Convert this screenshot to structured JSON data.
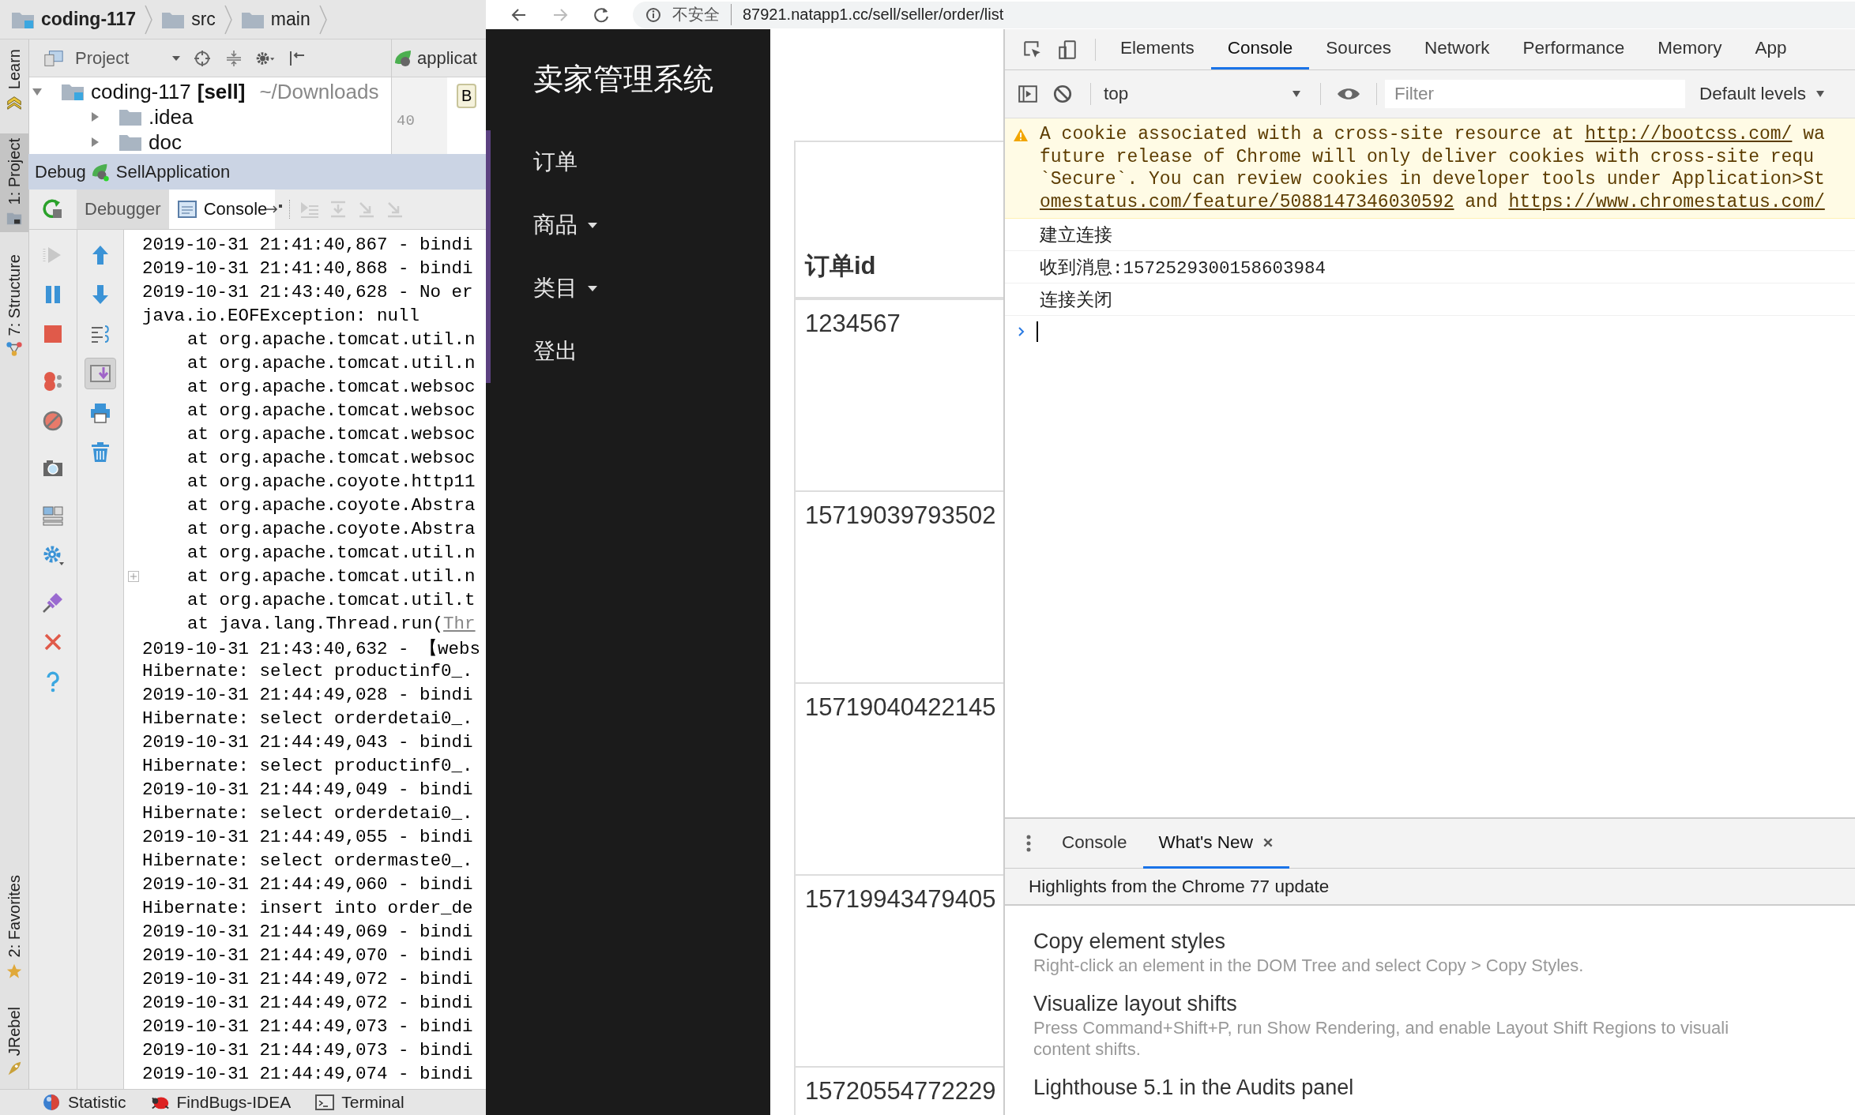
{
  "ide": {
    "breadcrumbs": [
      "coding-117",
      "src",
      "main"
    ],
    "tool_strip_top": [
      {
        "label": "Learn",
        "selected": false
      },
      {
        "label": "1: Project",
        "selected": true
      },
      {
        "label": "7: Structure",
        "selected": false
      }
    ],
    "tool_strip_bottom": [
      {
        "label": "2: Favorites",
        "selected": false
      },
      {
        "label": "JRebel",
        "selected": false
      }
    ],
    "project_panel": {
      "title": "Project",
      "tree": [
        {
          "name": "coding-117",
          "module": "[sell]",
          "path": "~/Downloads",
          "expanded": true,
          "children": [
            {
              "name": ".idea",
              "expanded": false
            },
            {
              "name": "doc",
              "expanded": false
            }
          ]
        }
      ]
    },
    "editor": {
      "tab": "applicat",
      "button": "B",
      "line_number": "40"
    },
    "debug": {
      "title": "Debug",
      "config": "SellApplication",
      "tabs": [
        {
          "label": "Debugger",
          "selected": false
        },
        {
          "label": "Console",
          "selected": true
        }
      ],
      "log": [
        {
          "kind": "text",
          "text": "2019-10-31 21:41:40,867 - bindi"
        },
        {
          "kind": "text",
          "text": "2019-10-31 21:41:40,868 - bindi"
        },
        {
          "kind": "text",
          "text": "2019-10-31 21:43:40,628 - No er"
        },
        {
          "kind": "text",
          "text": "java.io.EOFException: null"
        },
        {
          "kind": "stack",
          "text": "at org.apache.tomcat.util.n"
        },
        {
          "kind": "stack",
          "text": "at org.apache.tomcat.util.n"
        },
        {
          "kind": "stack",
          "text": "at org.apache.tomcat.websoc"
        },
        {
          "kind": "stack",
          "text": "at org.apache.tomcat.websoc"
        },
        {
          "kind": "stack",
          "text": "at org.apache.tomcat.websoc"
        },
        {
          "kind": "stack",
          "text": "at org.apache.tomcat.websoc"
        },
        {
          "kind": "stack",
          "text": "at org.apache.coyote.http11"
        },
        {
          "kind": "stack",
          "text": "at org.apache.coyote.Abstra"
        },
        {
          "kind": "stack",
          "text": "at org.apache.coyote.Abstra"
        },
        {
          "kind": "stack",
          "text": "at org.apache.tomcat.util.n"
        },
        {
          "kind": "stack_fold",
          "text": "at org.apache.tomcat.util.n"
        },
        {
          "kind": "stack",
          "text": "at org.apache.tomcat.util.t"
        },
        {
          "kind": "stack",
          "text": "at java.lang.Thread.run(",
          "link": "Thr"
        },
        {
          "kind": "text",
          "text": "2019-10-31 21:43:40,632 - 【webs"
        },
        {
          "kind": "text",
          "text": "Hibernate: select productinf0_."
        },
        {
          "kind": "text",
          "text": "2019-10-31 21:44:49,028 - bindi"
        },
        {
          "kind": "text",
          "text": "Hibernate: select orderdetai0_."
        },
        {
          "kind": "text",
          "text": "2019-10-31 21:44:49,043 - bindi"
        },
        {
          "kind": "text",
          "text": "Hibernate: select productinf0_."
        },
        {
          "kind": "text",
          "text": "2019-10-31 21:44:49,049 - bindi"
        },
        {
          "kind": "text",
          "text": "Hibernate: select orderdetai0_."
        },
        {
          "kind": "text",
          "text": "2019-10-31 21:44:49,055 - bindi"
        },
        {
          "kind": "text",
          "text": "Hibernate: select ordermaste0_."
        },
        {
          "kind": "text",
          "text": "2019-10-31 21:44:49,060 - bindi"
        },
        {
          "kind": "text",
          "text": "Hibernate: insert into order_de"
        },
        {
          "kind": "text",
          "text": "2019-10-31 21:44:49,069 - bindi"
        },
        {
          "kind": "text",
          "text": "2019-10-31 21:44:49,070 - bindi"
        },
        {
          "kind": "text",
          "text": "2019-10-31 21:44:49,072 - bindi"
        },
        {
          "kind": "text",
          "text": "2019-10-31 21:44:49,072 - bindi"
        },
        {
          "kind": "text",
          "text": "2019-10-31 21:44:49,073 - bindi"
        },
        {
          "kind": "text",
          "text": "2019-10-31 21:44:49,073 - bindi"
        },
        {
          "kind": "text",
          "text": "2019-10-31 21:44:49,074 - bindi"
        }
      ]
    },
    "bottom_tools": [
      "Statistic",
      "FindBugs-IDEA",
      "Terminal"
    ]
  },
  "browser": {
    "security": "不安全",
    "url": "87921.natapp1.cc/sell/seller/order/list",
    "app": {
      "title": "卖家管理系统",
      "nav": [
        {
          "label": "订单",
          "dropdown": false
        },
        {
          "label": "商品",
          "dropdown": true
        },
        {
          "label": "类目",
          "dropdown": true
        },
        {
          "label": "登出",
          "dropdown": false
        }
      ],
      "table": {
        "columns": [
          "订单id"
        ],
        "rows": [
          [
            "1234567"
          ],
          [
            "15719039793502"
          ],
          [
            "15719040422145"
          ],
          [
            "15719943479405"
          ],
          [
            "15720554772229"
          ]
        ]
      }
    },
    "devtools": {
      "tabs": [
        {
          "label": "Elements",
          "selected": false
        },
        {
          "label": "Console",
          "selected": true
        },
        {
          "label": "Sources",
          "selected": false
        },
        {
          "label": "Network",
          "selected": false
        },
        {
          "label": "Performance",
          "selected": false
        },
        {
          "label": "Memory",
          "selected": false
        },
        {
          "label": "App",
          "selected": false
        }
      ],
      "context": "top",
      "filter": {
        "placeholder": "Filter"
      },
      "levels": "Default levels",
      "messages": [
        {
          "kind": "warning",
          "lines": [
            [
              {
                "kind": "text",
                "text": "A cookie associated with a cross-site resource at "
              },
              {
                "kind": "link",
                "text": "http://bootcss.com/"
              },
              {
                "kind": "text",
                "text": " wa"
              }
            ],
            [
              {
                "kind": "text",
                "text": "future release of Chrome will only deliver cookies with cross-site requ"
              }
            ],
            [
              {
                "kind": "text",
                "text": "`Secure`. You can review cookies in developer tools under Application>St"
              }
            ],
            [
              {
                "kind": "link",
                "text": "omestatus.com/feature/5088147346030592"
              },
              {
                "kind": "text",
                "text": " and "
              },
              {
                "kind": "link",
                "text": "https://www.chromestatus.com/"
              }
            ]
          ]
        },
        {
          "kind": "log",
          "text": "建立连接"
        },
        {
          "kind": "log",
          "text": "收到消息:1572529300158603984"
        },
        {
          "kind": "log",
          "text": "连接关闭"
        }
      ],
      "drawer": {
        "tabs": [
          {
            "label": "Console",
            "selected": false,
            "closable": false
          },
          {
            "label": "What's New",
            "selected": true,
            "closable": true
          }
        ],
        "subtitle": "Highlights from the Chrome 77 update",
        "features": [
          {
            "title": "Copy element styles",
            "description": "Right-click an element in the DOM Tree and select Copy > Copy Styles."
          },
          {
            "title": "Visualize layout shifts",
            "description": "Press Command+Shift+P, run Show Rendering, and enable Layout Shift Regions to visuali\ncontent shifts."
          },
          {
            "title": "Lighthouse 5.1 in the Audits panel"
          }
        ]
      }
    }
  }
}
